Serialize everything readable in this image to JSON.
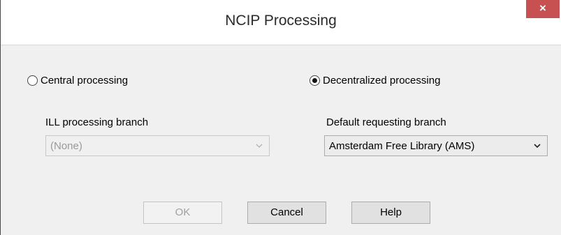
{
  "window": {
    "title": "NCIP Processing",
    "close_label": "×"
  },
  "processing_mode": {
    "central_label": "Central processing",
    "decentralized_label": "Decentralized processing",
    "selected": "decentralized"
  },
  "ill_branch": {
    "label": "ILL processing branch",
    "value": "(None)",
    "enabled": false
  },
  "default_branch": {
    "label": "Default requesting branch",
    "value": "Amsterdam Free Library (AMS)",
    "enabled": true
  },
  "buttons": {
    "ok_label": "OK",
    "ok_enabled": false,
    "cancel_label": "Cancel",
    "help_label": "Help"
  },
  "icons": {
    "close": "close-icon",
    "dropdown": "chevron-down-icon"
  }
}
